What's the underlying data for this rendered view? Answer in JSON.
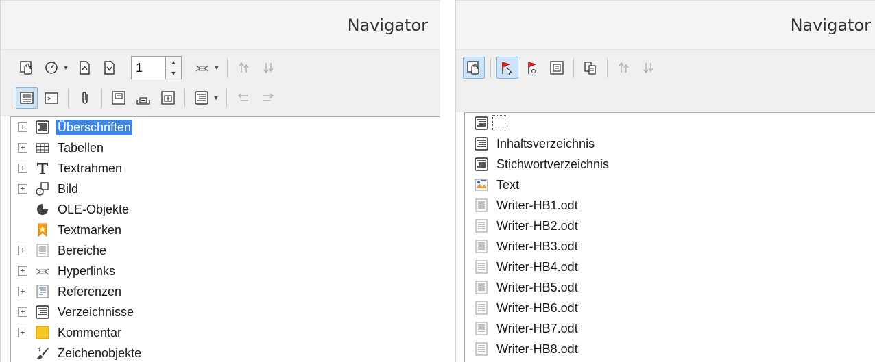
{
  "left": {
    "title": "Navigator",
    "page_number": "1",
    "tree": [
      {
        "label": "Überschriften",
        "icon": "headings-icon",
        "expandable": true,
        "selected": true
      },
      {
        "label": "Tabellen",
        "icon": "table-icon",
        "expandable": true
      },
      {
        "label": "Textrahmen",
        "icon": "text-frame-icon",
        "expandable": true
      },
      {
        "label": "Bild",
        "icon": "image-icon",
        "expandable": true
      },
      {
        "label": "OLE-Objekte",
        "icon": "ole-object-icon",
        "expandable": false
      },
      {
        "label": "Textmarken",
        "icon": "bookmark-icon",
        "expandable": false
      },
      {
        "label": "Bereiche",
        "icon": "section-icon",
        "expandable": true
      },
      {
        "label": "Hyperlinks",
        "icon": "hyperlink-icon",
        "expandable": true
      },
      {
        "label": "Referenzen",
        "icon": "reference-icon",
        "expandable": true
      },
      {
        "label": "Verzeichnisse",
        "icon": "index-icon",
        "expandable": true
      },
      {
        "label": "Kommentar",
        "icon": "comment-icon",
        "expandable": true
      },
      {
        "label": "Zeichenobjekte",
        "icon": "drawing-object-icon",
        "expandable": false
      }
    ]
  },
  "right": {
    "title": "Navigator",
    "tree": [
      {
        "label": "",
        "icon": "index-icon"
      },
      {
        "label": "Inhaltsverzeichnis",
        "icon": "index-icon"
      },
      {
        "label": "Stichwortverzeichnis",
        "icon": "index-icon"
      },
      {
        "label": "Text",
        "icon": "text-document-icon"
      },
      {
        "label": "Writer-HB1.odt",
        "icon": "section-icon"
      },
      {
        "label": "Writer-HB2.odt",
        "icon": "section-icon"
      },
      {
        "label": "Writer-HB3.odt",
        "icon": "section-icon"
      },
      {
        "label": "Writer-HB4.odt",
        "icon": "section-icon"
      },
      {
        "label": "Writer-HB5.odt",
        "icon": "section-icon"
      },
      {
        "label": "Writer-HB6.odt",
        "icon": "section-icon"
      },
      {
        "label": "Writer-HB7.odt",
        "icon": "section-icon"
      },
      {
        "label": "Writer-HB8.odt",
        "icon": "section-icon"
      }
    ]
  }
}
